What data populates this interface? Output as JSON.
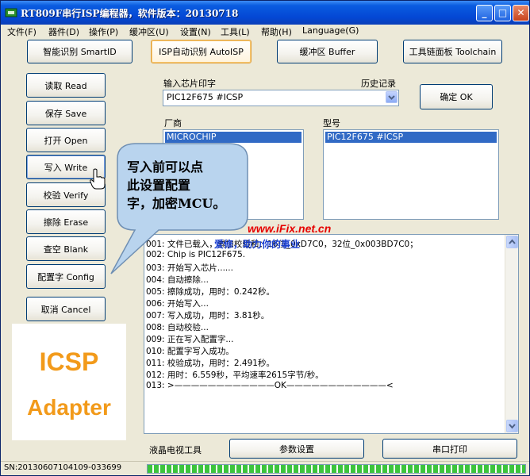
{
  "window": {
    "title": "RT809F串行ISP编程器，软件版本：20130718",
    "minimize": "_",
    "maximize": "□",
    "close": "✕"
  },
  "menu": [
    "文件(F)",
    "器件(D)",
    "操作(P)",
    "缓冲区(U)",
    "设置(N)",
    "工具(L)",
    "帮助(H)",
    "Language(G)"
  ],
  "top_buttons": {
    "smart_id": "智能识别 SmartID",
    "auto_isp": "ISP自动识别 AutoISP",
    "buffer": "缓冲区 Buffer",
    "toolchain": "工具链面板 Toolchain"
  },
  "side_buttons": {
    "read": "读取 Read",
    "save": "保存 Save",
    "open": "打开 Open",
    "write": "写入 Write",
    "verify": "校验 Verify",
    "erase": "擦除 Erase",
    "blank": "查空 Blank",
    "config": "配置字 Config",
    "cancel": "取消 Cancel"
  },
  "chip": {
    "input_label": "输入芯片印字",
    "history_label": "历史记录",
    "input_value": "PIC12F675 #ICSP",
    "ok_button": "确定 OK",
    "vendor_label": "厂商",
    "vendor_selected": "MICROCHIP",
    "model_label": "型号",
    "model_selected": "PIC12F675 #ICSP"
  },
  "log": [
    "001: 文件已载入，累加校验和：16位_0xD7C0，32位_0x003BD7C0；",
    "002: Chip is PIC12F675.",
    "003: 开始写入芯片......",
    "004: 自动擦除...",
    "005: 擦除成功，用时：0.242秒。",
    "006: 开始写入...",
    "007: 写入成功，用时：3.81秒。",
    "008: 自动校验...",
    "009: 正在写入配置字...",
    "010: 配置字写入成功。",
    "011: 校验成功，用时：2.491秒。",
    "012: 用时：6.559秒，平均速率2615字节/秒。",
    "013: >————————————OK————————————<"
  ],
  "bottom": {
    "lcd_tools": "液晶电视工具",
    "params": "参数设置",
    "serial_print": "串口打印"
  },
  "status": {
    "sn": "SN:20130607104109-033699",
    "progress_fraction": 1.0
  },
  "logo": {
    "line1": "ICSP",
    "line2": "Adapter"
  },
  "callout": {
    "line1": "写入前可以点",
    "line2": "此设置配置",
    "line3": "字，加密MCU。"
  },
  "watermark": {
    "site": "www.iFix.net.cn",
    "slogan": "爱修，助力你的事业"
  },
  "colors": {
    "title_bar": "#0447d4",
    "selection": "#316ac5",
    "logo": "#f29a1a",
    "callout_fill": "#b9d4ee",
    "progress": "#3cc43c"
  }
}
